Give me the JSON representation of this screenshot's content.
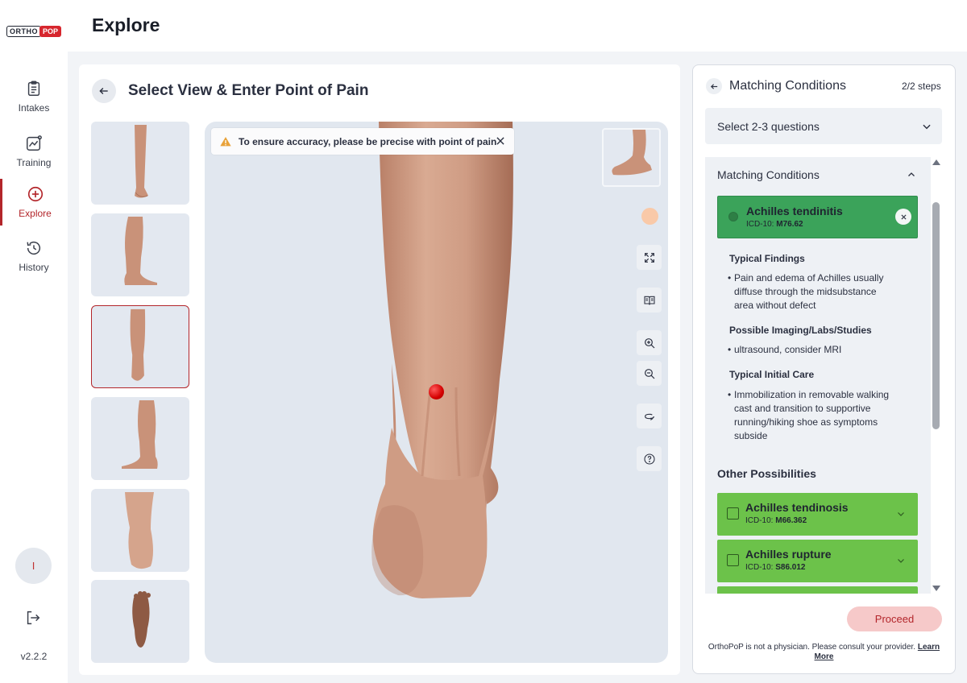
{
  "app": {
    "logo_left": "ORTHO",
    "logo_right": "POP",
    "page_title": "Explore",
    "version": "v2.2.2",
    "avatar_initial": "I"
  },
  "sidebar": {
    "items": [
      {
        "label": "Intakes",
        "icon": "clipboard-icon"
      },
      {
        "label": "Training",
        "icon": "chart-icon"
      },
      {
        "label": "Explore",
        "icon": "plus-circle-icon",
        "active": true
      },
      {
        "label": "History",
        "icon": "history-icon"
      }
    ]
  },
  "viewer": {
    "title": "Select View & Enter Point of Pain",
    "warning": "To ensure accuracy, please be precise with point of pain",
    "thumbnails": [
      "front-view",
      "side-view-left",
      "back-view",
      "side-view-right",
      "top-view",
      "sole-view"
    ],
    "selected_thumbnail": "back-view",
    "skin_color": "#f9c9a8"
  },
  "panel": {
    "title": "Matching Conditions",
    "steps": "2/2 steps",
    "select_label": "Select 2-3 questions",
    "section_header": "Matching Conditions",
    "primary": {
      "name": "Achilles tendinitis",
      "code_prefix": "ICD-10:",
      "code": "M76.62"
    },
    "details": {
      "findings_h": "Typical Findings",
      "findings": "Pain and edema of Achilles usually diffuse through the midsubstance area without defect",
      "imaging_h": "Possible Imaging/Labs/Studies",
      "imaging": "ultrasound, consider MRI",
      "care_h": "Typical Initial Care",
      "care": "Immobilization in removable walking cast and transition to supportive running/hiking shoe as symptoms subside"
    },
    "other_h": "Other Possibilities",
    "others": [
      {
        "name": "Achilles tendinosis",
        "code_prefix": "ICD-10:",
        "code": "M66.362"
      },
      {
        "name": "Achilles rupture",
        "code_prefix": "ICD-10:",
        "code": "S86.012"
      }
    ],
    "proceed": "Proceed",
    "disclaimer": "OrthoPoP is not a physician. Please consult your provider.",
    "learn_more": "Learn More"
  },
  "colors": {
    "accent": "#b3262b",
    "primary_condition": "#3ba35a",
    "other_condition": "#6cc24a"
  }
}
